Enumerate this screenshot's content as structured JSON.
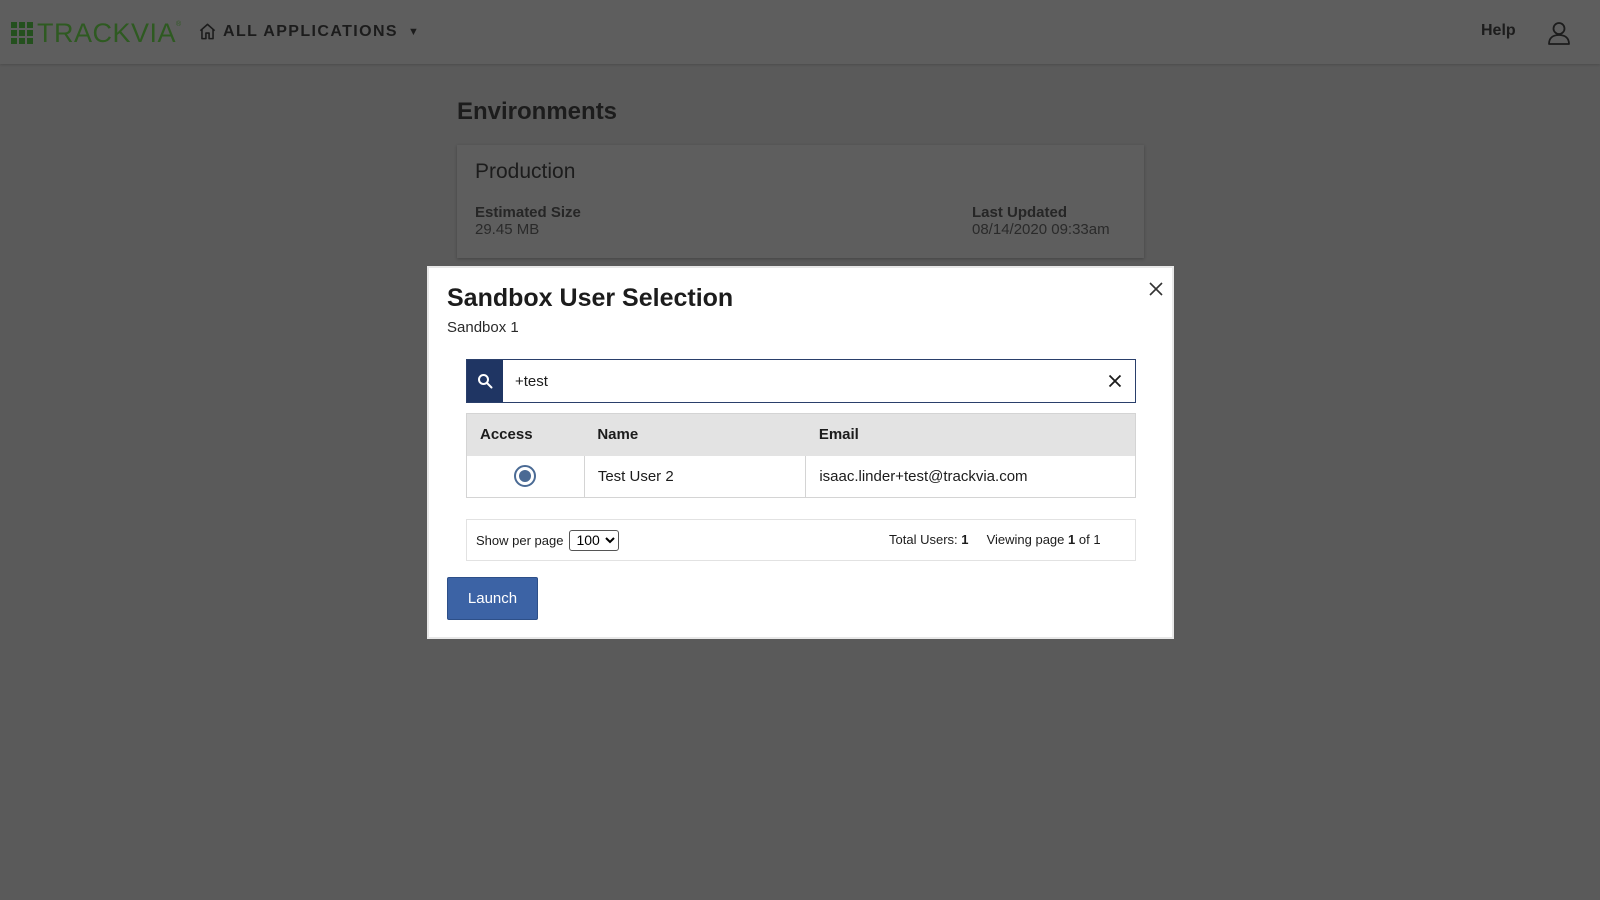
{
  "header": {
    "logo_text": "TRACKVIA",
    "logo_mark": "®",
    "apps_label": "ALL APPLICATIONS",
    "apps_caret": "▼",
    "help_label": "Help"
  },
  "page": {
    "title": "Environments",
    "environment": {
      "name": "Production",
      "size_label": "Estimated Size",
      "size_value": "29.45 MB",
      "updated_label": "Last Updated",
      "updated_value": "08/14/2020 09:33am"
    }
  },
  "modal": {
    "title": "Sandbox User Selection",
    "subtitle": "Sandbox 1",
    "search": {
      "value": "+test",
      "placeholder": ""
    },
    "table": {
      "columns": [
        "Access",
        "Name",
        "Email"
      ],
      "rows": [
        {
          "selected": true,
          "name": "Test User 2",
          "email": "isaac.linder+test@trackvia.com"
        }
      ]
    },
    "pager": {
      "per_page_label": "Show per page",
      "per_page_value": "100",
      "total_label": "Total Users:",
      "total_value": "1",
      "viewing_label": "Viewing page",
      "page_current": "1",
      "of_label": "of",
      "page_total": "1"
    },
    "launch_label": "Launch"
  },
  "icons": {
    "home": "home-icon",
    "user": "user-icon",
    "search": "search-icon",
    "close": "close-icon",
    "clear": "clear-icon"
  },
  "colors": {
    "overlay": "#5a5a5a",
    "logo_green": "#2e5a21",
    "search_button": "#1f3563",
    "radio": "#4a6a94",
    "launch_button": "#3c63a5"
  }
}
